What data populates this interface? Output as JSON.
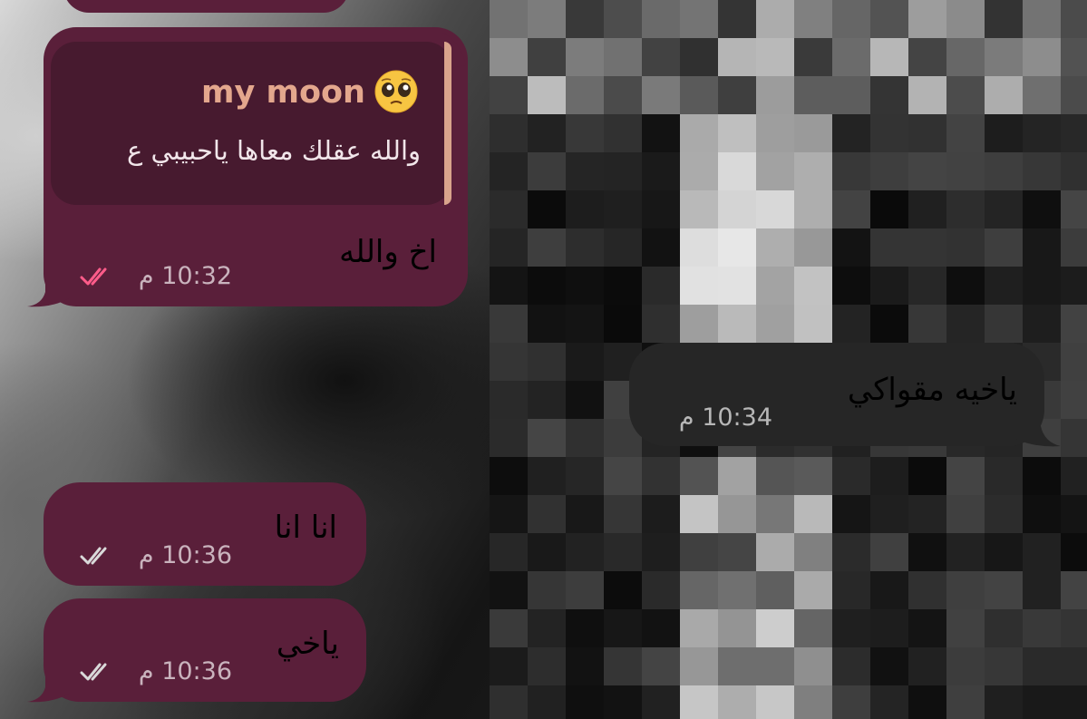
{
  "messages": [
    {
      "id": "m1",
      "direction": "outgoing",
      "reply": {
        "sender": "my moon",
        "sender_emoji": "pleading-face-emoji",
        "text": "والله عقلك معاها ياحبيبي ع"
      },
      "text": "اخ والله",
      "time": "10:32 م",
      "read": true
    },
    {
      "id": "m2",
      "direction": "incoming",
      "text": "ياخيه مقواكي",
      "time": "10:34 م"
    },
    {
      "id": "m3",
      "direction": "outgoing",
      "text": "انا انا",
      "time": "10:36 م",
      "read": false
    },
    {
      "id": "m4",
      "direction": "outgoing",
      "text": "ياخي",
      "time": "10:36 م",
      "read": false
    }
  ],
  "colors": {
    "outgoing_bubble": "#5a1f3a",
    "reply_block": "#471a2f",
    "reply_accent": "#d9a48c",
    "incoming_bubble": "#262626",
    "read_checks": "#ff5c8a",
    "delivered_checks": "#d9d9d9"
  },
  "icons": {
    "read_indicator": "double-check-icon",
    "reply_emoji": "pleading-face-emoji"
  }
}
